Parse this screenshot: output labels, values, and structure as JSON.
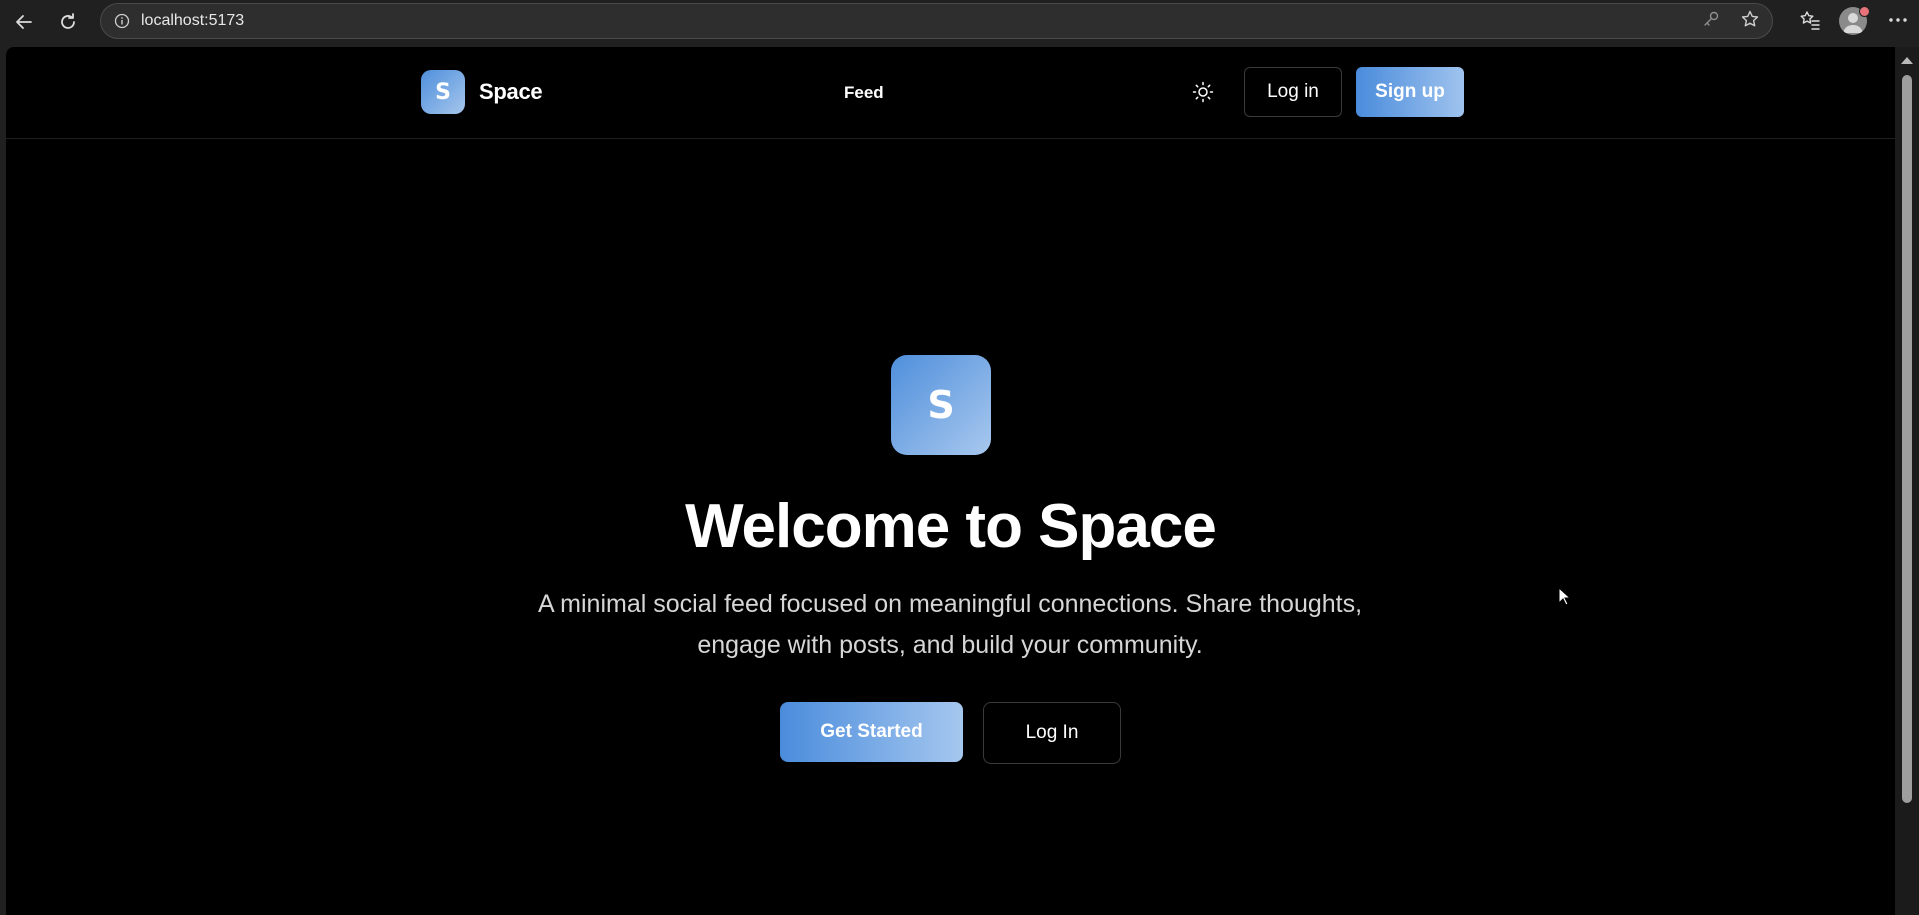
{
  "browser": {
    "url": "localhost:5173",
    "icons": [
      "back-arrow-icon",
      "reload-icon",
      "site-info-icon",
      "key-icon",
      "star-icon",
      "favorites-icon",
      "profile-avatar",
      "more-icon"
    ]
  },
  "header": {
    "logo_letter": "S",
    "brand": "Space",
    "nav": {
      "feed": "Feed"
    },
    "theme_icon": "sun-icon",
    "login": "Log in",
    "signup": "Sign up"
  },
  "hero": {
    "logo_letter": "S",
    "title": "Welcome to Space",
    "subtitle": "A minimal social feed focused on meaningful connections. Share thoughts, engage with posts, and build your community.",
    "get_started": "Get Started",
    "login": "Log In"
  },
  "colors": {
    "accent_start": "#4a8cdc",
    "accent_end": "#a5c7ef",
    "page_bg": "#000000",
    "chrome_bg": "#202020"
  }
}
